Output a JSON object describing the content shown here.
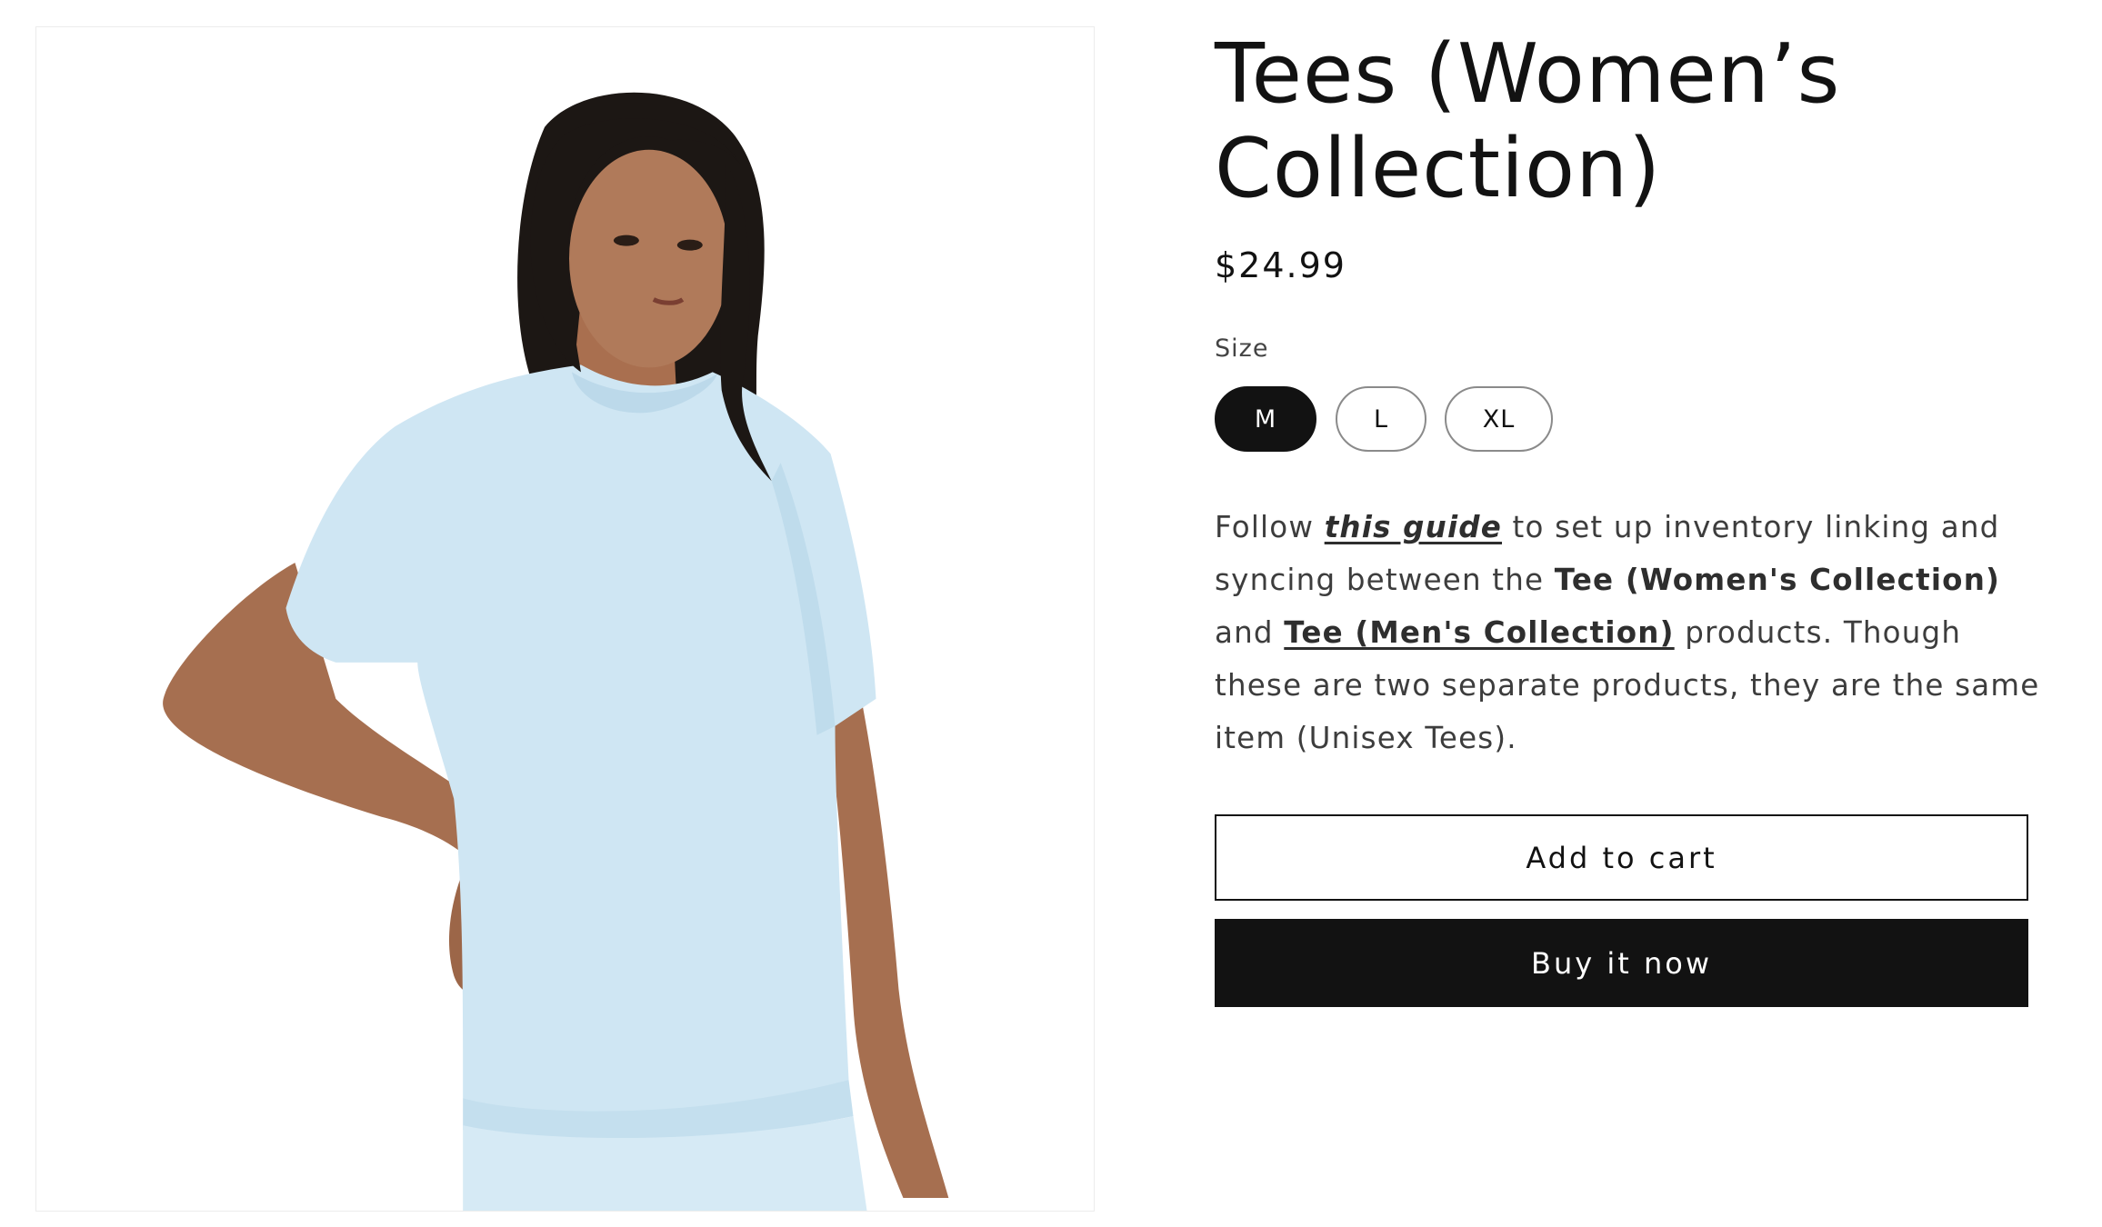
{
  "product": {
    "title": "Tees (Women’s Collection)",
    "price": "$24.99",
    "image_alt": "Woman wearing a light blue t-shirt"
  },
  "size": {
    "label": "Size",
    "options": [
      "M",
      "L",
      "XL"
    ],
    "selected": "M"
  },
  "description": {
    "t1": "Follow ",
    "guide_link": "this guide",
    "t2": " to set up inventory linking and syncing between the ",
    "women_product": "Tee (Women's Collection)",
    "t3": " and ",
    "men_link": "Tee (Men's Collection)",
    "t4": " products. Though these are two separate products, they are the same item (Unisex Tees)."
  },
  "actions": {
    "add_to_cart": "Add to cart",
    "buy_now": "Buy it now"
  },
  "colors": {
    "text": "#121212",
    "button_dark": "#121212",
    "shirt": "#cfe6f3",
    "skin": "#b07a5a",
    "hair": "#1c1714"
  }
}
